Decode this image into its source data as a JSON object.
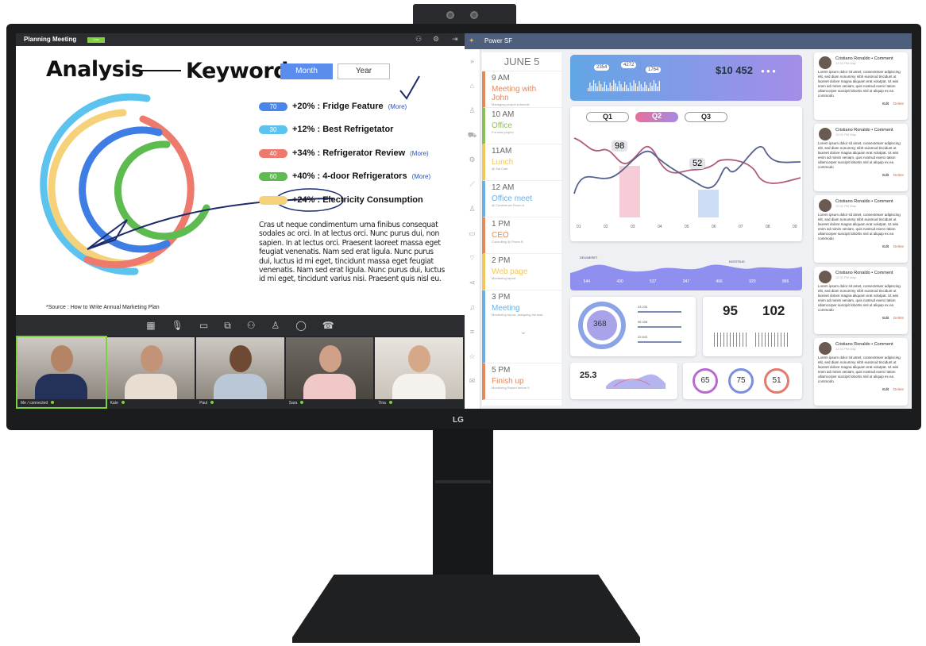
{
  "brand": "LG",
  "left_app": {
    "title": "Planning Meeting",
    "live_label": "Live",
    "header_icons": [
      "participants-icon",
      "gear-icon",
      "exit-icon"
    ],
    "heading_left": "Analysis",
    "heading_right": "Keyword",
    "toggle": {
      "month": "Month",
      "year": "Year",
      "selected": "Month"
    },
    "keywords": [
      {
        "badge": "70",
        "text": "+20% : Fridge Feature",
        "more": "(More)",
        "color": "#4a86e8"
      },
      {
        "badge": "30",
        "text": "+12% : Best Refrigetator",
        "more": "",
        "color": "#5cc3ee"
      },
      {
        "badge": "40",
        "text": "+34% : Refrigerator Review",
        "more": "(More)",
        "color": "#ee7a6e"
      },
      {
        "badge": "60",
        "text": "+40% : 4-door Refrigerators",
        "more": "(More)",
        "color": "#5dbb50"
      },
      {
        "badge": "",
        "text": "+24% : Electricity Consumption",
        "more": "",
        "color": "#f5d27a"
      }
    ],
    "paragraph": "Cras ut neque condimentum urna finibus consequat sodales ac orci. In at lectus orci. Nunc purus dui, non sapien.  In at lectus orci. Praesent laoreet massa eget feugiat venenatis. Nam sed erat ligula. Nunc purus dui, luctus id mi eget, tincidunt massa eget feugiat venenatis. Nam sed erat ligula. Nunc purus dui, luctus id mi eget, tincidunt varius nisi. Praesent quis nisl eu.",
    "source": "*Source : How to Write Annual Marketing Plan",
    "toolbar_icons": [
      "layout-icon",
      "microphone-icon",
      "camera-icon",
      "share-screen-icon",
      "participants-icon",
      "add-user-icon",
      "chat-icon",
      "hang-up-icon"
    ],
    "participants": [
      {
        "name": "Me / connected"
      },
      {
        "name": "Kate"
      },
      {
        "name": "Paul"
      },
      {
        "name": "Sara"
      },
      {
        "name": "Tina"
      }
    ]
  },
  "right_app": {
    "title": "Power SF",
    "calendar": {
      "date": "JUNE 5",
      "events": [
        {
          "time": "9 AM",
          "name": "Meeting with John",
          "detail": "Managing project schedule",
          "color": "#e08a5c"
        },
        {
          "time": "10 AM",
          "name": "Office",
          "detail": "For new project",
          "color": "#8bbf5a"
        },
        {
          "time": "11AM",
          "name": "Lunch",
          "detail": "@ Sal Cafe",
          "color": "#f1c75b"
        },
        {
          "time": "12 AM",
          "name": "Office meet",
          "detail": "@ Conference Room A",
          "color": "#6ab0e6"
        },
        {
          "time": "1 PM",
          "name": "CEO",
          "detail": "Consulting @ Room B",
          "color": "#e08a5c"
        },
        {
          "time": "2 PM",
          "name": "Web page",
          "detail": "Monitoring report",
          "color": "#f1c75b"
        },
        {
          "time": "3 PM",
          "name": "Meeting",
          "detail": "Monitoring report, assigning the task",
          "color": "#6ab0e6"
        },
        {
          "time": "5 PM",
          "name": "Finish up",
          "detail": "Monitoring Report before 5",
          "color": "#e08a5c"
        }
      ]
    },
    "dashboard": {
      "amount": "$10 452",
      "bubbles": [
        "2354",
        "4272",
        "1764"
      ],
      "quarters": [
        "Q1",
        "Q2",
        "Q3"
      ],
      "selected_quarter": "Q2",
      "callouts": [
        "98",
        "52"
      ],
      "x_ticks": [
        "01",
        "02",
        "03",
        "04",
        "05",
        "06",
        "07",
        "08",
        "09"
      ],
      "wave_legend": [
        "DEUMERET",
        "NOSTRUD"
      ],
      "wave_values": [
        "544",
        "430",
        "537",
        "347",
        "466",
        "920",
        "966"
      ],
      "ring_value": "368",
      "bar_labels": [
        "43 230",
        "98 408",
        "33 843"
      ],
      "stats": [
        "95",
        "102"
      ],
      "small_value": "25.3",
      "donuts": [
        {
          "value": "65",
          "color": "#b86ad1"
        },
        {
          "value": "75",
          "color": "#7a8de0"
        },
        {
          "value": "51",
          "color": "#e47a6e"
        }
      ]
    },
    "comments": [
      {
        "author": "Cristiano Ronaldo • Comment",
        "time": "12:31 PM May",
        "text": "Lorem ipsum dolor sit amet, consectetuer adipiscing elit, sed diam nonummy nibh euismod tincidunt ut laoreet dolore magna aliquam erat volutpat. Ut wisi enim ad minim veniam, quis nostrud exerci tation ullamcorper suscipit lobortis nisl ut aliquip ex ea commodo",
        "edit": "Edit",
        "delete": "Delete"
      },
      {
        "author": "Cristiano Ronaldo • Comment",
        "time": "12:31 PM May",
        "text": "Lorem ipsum dolor sit amet, consectetuer adipiscing elit, sed diam nonummy nibh euismod tincidunt ut laoreet dolore magna aliquam erat volutpat. Ut wisi enim ad minim veniam, quis nostrud exerci tation ullamcorper suscipit lobortis nisl ut aliquip ex ea commodo",
        "edit": "Edit",
        "delete": "Delete"
      },
      {
        "author": "Cristiano Ronaldo • Comment",
        "time": "12:31 PM May",
        "text": "Lorem ipsum dolor sit amet, consectetuer adipiscing elit, sed diam nonummy nibh euismod tincidunt ut laoreet dolore magna aliquam erat volutpat. Ut wisi enim ad minim veniam, quis nostrud exerci tation ullamcorper suscipit lobortis nisl ut aliquip ex ea commodo",
        "edit": "Edit",
        "delete": "Delete"
      },
      {
        "author": "Cristiano Ronaldo • Comment",
        "time": "12:31 PM May",
        "text": "Lorem ipsum dolor sit amet, consectetuer adipiscing elit, sed diam nonummy nibh euismod tincidunt ut laoreet dolore magna aliquam erat volutpat. Ut wisi enim ad minim veniam, quis nostrud exerci tation ullamcorper suscipit lobortis nisl ut aliquip ex ea commodo",
        "edit": "Edit",
        "delete": "Delete"
      },
      {
        "author": "Cristiano Ronaldo • Comment",
        "time": "12:31 PM May",
        "text": "Lorem ipsum dolor sit amet, consectetuer adipiscing elit, sed diam nonummy nibh euismod tincidunt ut laoreet dolore magna aliquam erat volutpat. Ut wisi enim ad minim veniam, quis nostrud exerci tation ullamcorper suscipit lobortis nisl ut aliquip ex ea commodo",
        "edit": "Edit",
        "delete": "Delete"
      }
    ]
  }
}
